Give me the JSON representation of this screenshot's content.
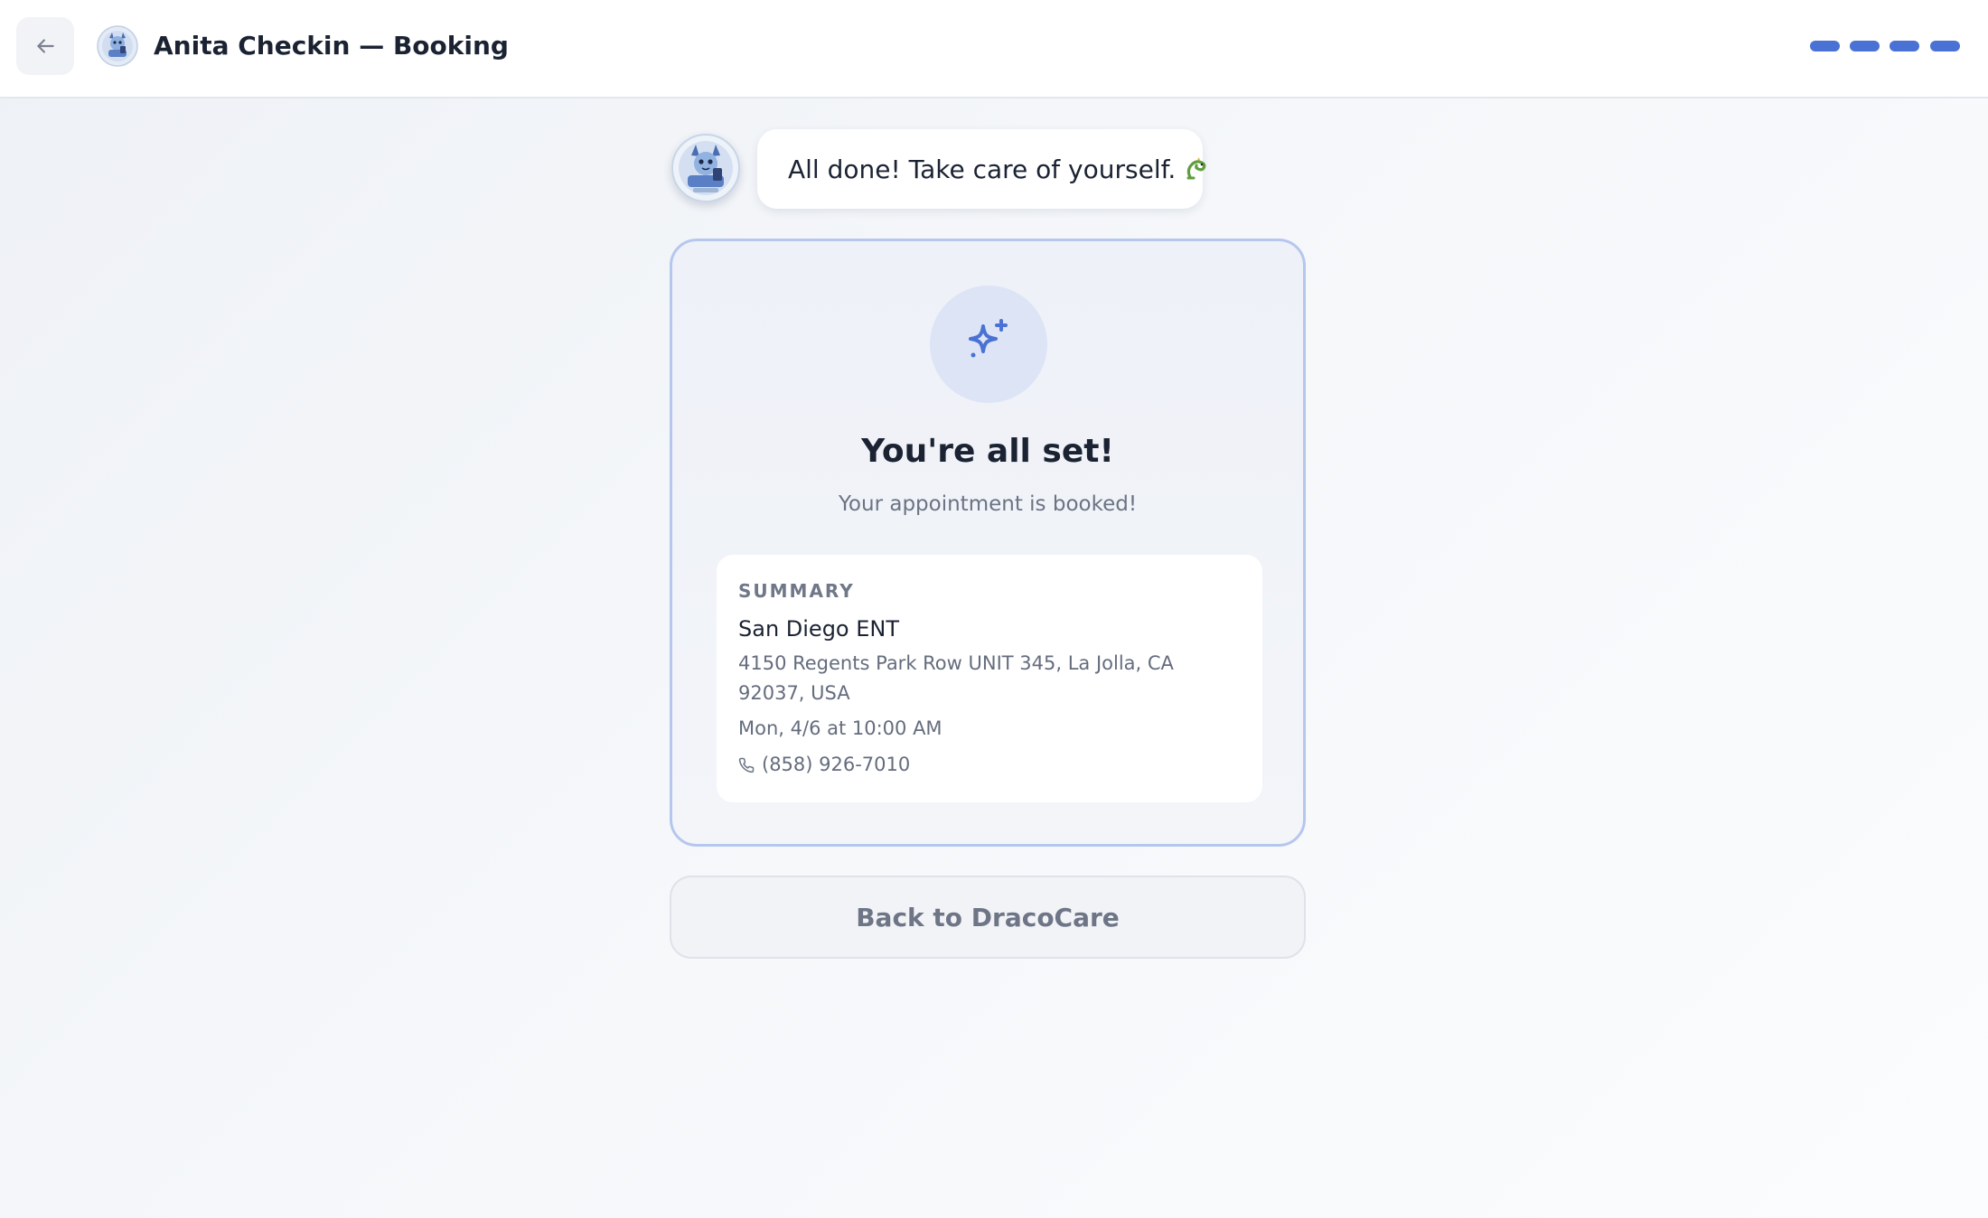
{
  "header": {
    "title": "Anita Checkin — Booking",
    "back_icon": "arrow-left-icon",
    "avatar_icon": "dragon-mascot-avatar",
    "progress": {
      "total_steps": 4,
      "completed_steps": 4,
      "color": "#4a72d4"
    }
  },
  "chat": {
    "message": "All done! Take care of yourself.",
    "emoji_icon": "dragon-emoji-icon"
  },
  "confirmation": {
    "icon": "sparkles-icon",
    "title": "You're all set!",
    "subtitle": "Your appointment is booked!",
    "summary": {
      "label": "SUMMARY",
      "provider_name": "San Diego ENT",
      "address": "4150 Regents Park Row UNIT 345, La Jolla, CA 92037, USA",
      "datetime": "Mon, 4/6 at 10:00 AM",
      "phone_icon": "phone-icon",
      "phone": "(858) 926-7010"
    }
  },
  "actions": {
    "back_to_app_label": "Back to DracoCare"
  },
  "colors": {
    "accent": "#4a72d4",
    "card_border": "#b6c7ee",
    "icon_circle": "#dde4f5"
  }
}
